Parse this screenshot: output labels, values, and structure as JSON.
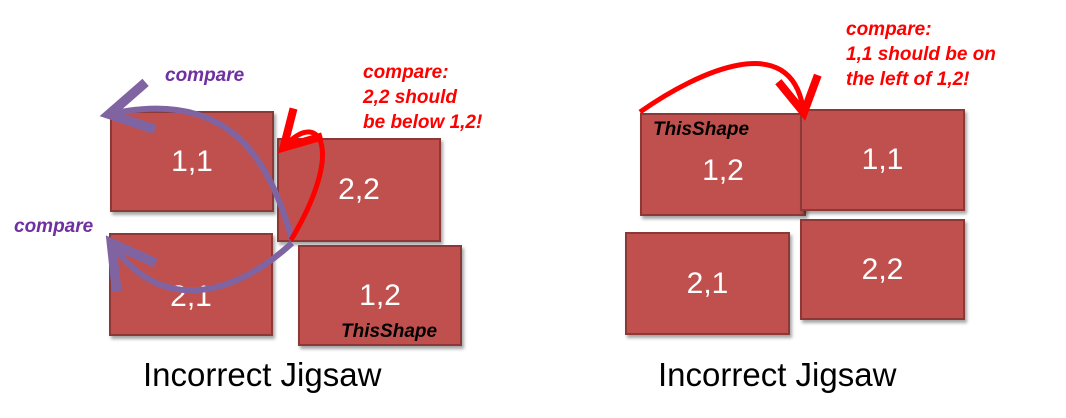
{
  "left_panel": {
    "tiles": {
      "a": "1,1",
      "b": "2,2",
      "c": "2,1",
      "d": "1,2"
    },
    "shape_tag": "ThisShape",
    "compare_top": "compare",
    "compare_side": "compare",
    "note": {
      "line1": "compare:",
      "line2": "2,2 should",
      "line3": "be below 1,2!"
    },
    "caption": "Incorrect Jigsaw"
  },
  "right_panel": {
    "tiles": {
      "a": "1,2",
      "b": "1,1",
      "c": "2,1",
      "d": "2,2"
    },
    "shape_tag": "ThisShape",
    "note": {
      "line1": "compare:",
      "line2": "1,1 should be on",
      "line3": "the left of 1,2!"
    },
    "caption": "Incorrect Jigsaw"
  },
  "colors": {
    "tile_fill": "#c0504d",
    "tile_border": "#8c3836",
    "arrow_red": "#ff0000",
    "arrow_purple": "#8064a2",
    "note_purple": "#7030a0"
  }
}
